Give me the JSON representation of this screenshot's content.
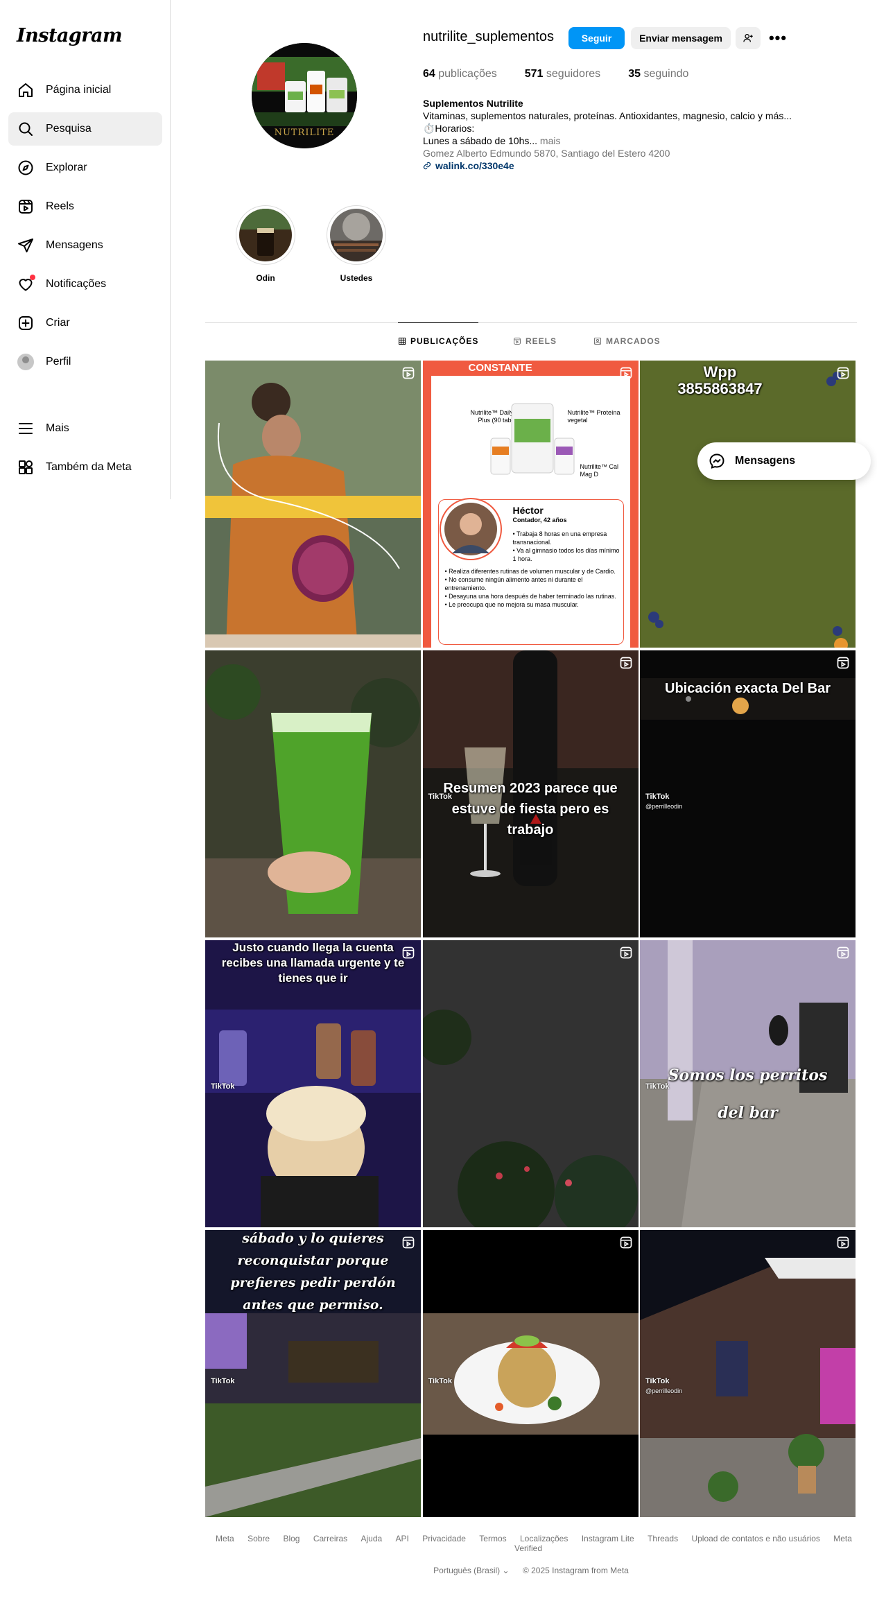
{
  "sidebar": {
    "logo": "Instagram",
    "items": [
      {
        "label": "Página inicial",
        "icon": "home-icon"
      },
      {
        "label": "Pesquisa",
        "icon": "search-icon",
        "active": true
      },
      {
        "label": "Explorar",
        "icon": "compass-icon"
      },
      {
        "label": "Reels",
        "icon": "reels-icon"
      },
      {
        "label": "Mensagens",
        "icon": "direct-icon"
      },
      {
        "label": "Notificações",
        "icon": "heart-icon"
      },
      {
        "label": "Criar",
        "icon": "plus-square-icon"
      },
      {
        "label": "Perfil",
        "icon": "avatar"
      }
    ],
    "bottom": [
      {
        "label": "Mais",
        "icon": "menu-icon"
      },
      {
        "label": "Também da Meta",
        "icon": "meta-apps-icon"
      }
    ]
  },
  "profile": {
    "username": "nutrilite_suplementos",
    "follow_label": "Seguir",
    "message_label": "Enviar mensagem",
    "stats": {
      "posts_num": "64",
      "posts_label": "publicações",
      "followers_num": "571",
      "followers_label": "seguidores",
      "following_num": "35",
      "following_label": "seguindo"
    },
    "bio": {
      "name": "Suplementos Nutrilite",
      "line1": "Vitaminas, suplementos naturales, proteínas. Antioxidantes, magnesio, calcio y más...",
      "line2": "⏱️Horarios:",
      "line3": "Lunes a sábado de 10hs...",
      "more": "mais",
      "address": "Gomez Alberto Edmundo 5870, Santiago del Estero 4200",
      "link": "walink.co/330e4e"
    },
    "pic_text": "NUTRILITE"
  },
  "highlights": [
    {
      "label": "Odin"
    },
    {
      "label": "Ustedes"
    }
  ],
  "tabs": [
    {
      "label": "PUBLICAÇÕES",
      "icon": "grid-icon",
      "active": true
    },
    {
      "label": "REELS",
      "icon": "reels-icon"
    },
    {
      "label": "MARCADOS",
      "icon": "tag-icon"
    }
  ],
  "posts": {
    "p2_banner": "CONSTANTE",
    "p2_prod1": "Nutrilite™ Daily Plus (90 tab)",
    "p2_prod2": "Nutrilite™ Proteína vegetal",
    "p2_prod3": "Nutrilite™ Cal Mag D",
    "p2_name": "Héctor",
    "p2_role": "Contador, 42 años",
    "p2_b1": "• Trabaja 8 horas en una empresa transnacional.",
    "p2_b2": "• Va al gimnasio todos los días mínimo 1 hora.",
    "p2_b3": "• Realiza diferentes rutinas de volumen muscular y de Cardio.",
    "p2_b4": "• No consume ningún alimento antes ni durante el entrenamiento.",
    "p2_b5": "• Desayuna una hora después de haber terminado las rutinas.",
    "p2_b6": "• Le preocupa que no mejora su masa muscular.",
    "p3_line1": "Wpp",
    "p3_line2": "3855863847",
    "p5_cap": "Resumen 2023 parece que estuve de fiesta pero es trabajo",
    "p6_cap": "Ubicación exacta Del Bar",
    "p7_cap": "Justo cuando llega la cuenta recibes una llamada urgente y te tienes que ir",
    "p9_cap": "Somos los perritos del bar",
    "p10_cap": "sábado y lo quieres reconquistar porque prefieres pedir perdón antes que permiso.",
    "tiktok": "TikTok",
    "tiktok_handle": "@perrilleodin"
  },
  "float_message": "Mensagens",
  "footer": {
    "links": [
      "Meta",
      "Sobre",
      "Blog",
      "Carreiras",
      "Ajuda",
      "API",
      "Privacidade",
      "Termos",
      "Localizações",
      "Instagram Lite",
      "Threads",
      "Upload de contatos e não usuários",
      "Meta Verified"
    ],
    "language": "Português (Brasil)",
    "copyright": "© 2025 Instagram from Meta"
  },
  "colors": {
    "accent": "#0095f6",
    "notification": "#ff3040",
    "link": "#00376b"
  }
}
